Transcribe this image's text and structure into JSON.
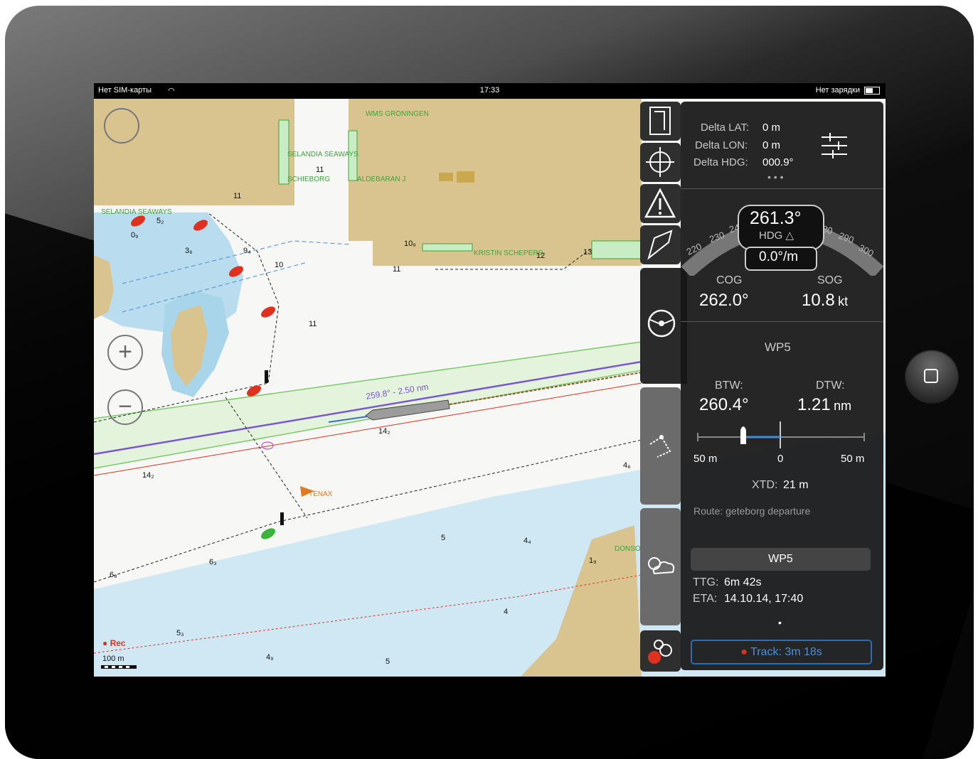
{
  "status_bar": {
    "carrier": "Нет SIM-карты",
    "time": "17:33",
    "battery_text": "Нет зарядки"
  },
  "map": {
    "labels": [
      "WMS GRONINGEN",
      "SELANDIA SEAWAYS",
      "SCHIEBORG",
      "ALDEBARAN J",
      "KRISTIN SCHEPERS",
      "SELANDIA SEAWAYS",
      "TENAX",
      "DONSO"
    ],
    "route_label": "259.8° - 2.50 nm",
    "depths": [
      "11",
      "11",
      "11",
      "11",
      "0₉",
      "3₆",
      "9₄",
      "10",
      "10₉",
      "12",
      "13",
      "14₂",
      "14₂",
      "4₆",
      "6₃",
      "6₈",
      "5₃",
      "4₉",
      "5",
      "5",
      "4₄",
      "1₉",
      "4",
      "5₂"
    ],
    "rec_label": "Rec",
    "scale_label": "100 m"
  },
  "controls": {
    "zoom_in": "+",
    "zoom_out": "−"
  },
  "panel": {
    "delta_lat_label": "Delta LAT:",
    "delta_lat_value": "0 m",
    "delta_lon_label": "Delta LON:",
    "delta_lon_value": "0 m",
    "delta_hdg_label": "Delta HDG:",
    "delta_hdg_value": "000.9°",
    "hdg_value": "261.3°",
    "hdg_label": "HDG △",
    "rot_value": "0.0°/m",
    "compass_ticks_left": [
      "220",
      "230",
      "240"
    ],
    "compass_ticks_right": [
      "280",
      "290",
      "300"
    ],
    "cog_label": "COG",
    "cog_value": "262.0°",
    "sog_label": "SOG",
    "sog_value": "10.8",
    "sog_unit": "kt",
    "waypoint_title": "WP5",
    "btw_label": "BTW:",
    "btw_value": "260.4°",
    "dtw_label": "DTW:",
    "dtw_value": "1.21",
    "dtw_unit": "nm",
    "xte_left": "50 m",
    "xte_mid": "0",
    "xte_right": "50 m",
    "xtd_label": "XTD:",
    "xtd_value": "21 m",
    "route_label": "Route: geteborg departure",
    "wp_button": "WP5",
    "ttg_label": "TTG:",
    "ttg_value": "6m 42s",
    "eta_label": "ETA:",
    "eta_value": "14.10.14, 17:40",
    "track_button": "Track: 3m 18s"
  },
  "colors": {
    "land": "#d9c48f",
    "shallow": "#b9dcef",
    "route": "#7a55d6",
    "accent_red": "#e0301e",
    "lane_green": "#8cd17a"
  }
}
